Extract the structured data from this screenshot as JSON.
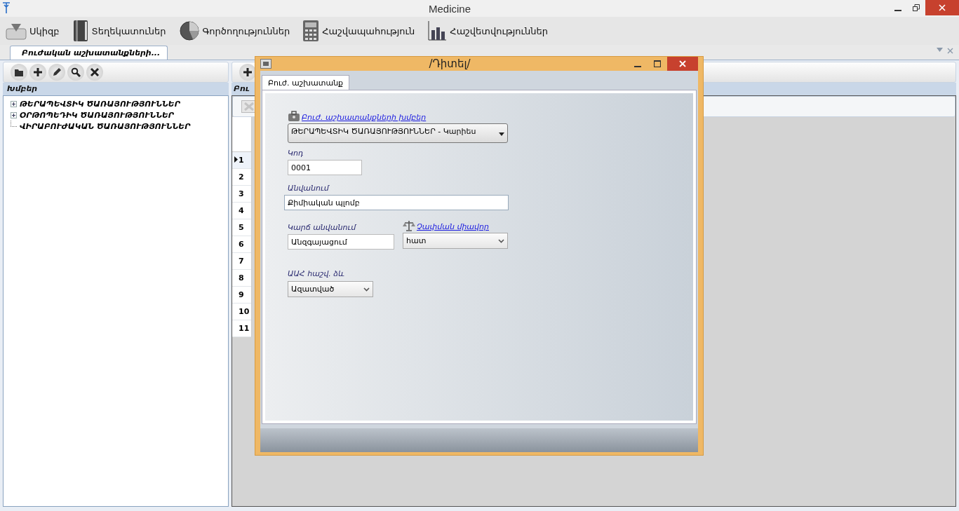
{
  "window": {
    "title": "Medicine"
  },
  "main_toolbar": [
    {
      "kind": "home",
      "label": "Սկիզբ"
    },
    {
      "kind": "book",
      "label": "Տեղեկատուներ"
    },
    {
      "kind": "pie",
      "label": "Գործողություններ"
    },
    {
      "kind": "calculator",
      "label": "Հաշվապահություն"
    },
    {
      "kind": "chart",
      "label": "Հաշվետվություններ"
    }
  ],
  "doc_tabs": [
    {
      "label": "Բուժական աշխատանքների...",
      "selected": true
    }
  ],
  "groups_panel": {
    "header": "Խմբեր",
    "tree": [
      {
        "label": "ԹԵՐԱՊԵՎՏԻԿ ԾԱՌԱՅՈՒԹՅՈՒՆՆԵՐ",
        "kind": "group"
      },
      {
        "label": "ՕՐԹՈՊԵԴԻԿ ԾԱՌԱՅՈՒԹՅՈՒՆՆԵՐ",
        "kind": "group"
      },
      {
        "label": "ՎԻՐԱԲՈՒԺԱԿԱՆ ԾԱՌԱՅՈՒԹՅՈՒՆՆԵՐ",
        "kind": "leaf"
      }
    ]
  },
  "services_panel": {
    "header": "Բու",
    "rows": [
      {
        "number": "1",
        "selected": true
      },
      {
        "number": "2",
        "selected": false
      },
      {
        "number": "3",
        "selected": false
      },
      {
        "number": "4",
        "selected": false
      },
      {
        "number": "5",
        "selected": false
      },
      {
        "number": "6",
        "selected": false
      },
      {
        "number": "7",
        "selected": false
      },
      {
        "number": "8",
        "selected": false
      },
      {
        "number": "9",
        "selected": false
      },
      {
        "number": "10",
        "selected": false
      },
      {
        "number": "11",
        "selected": false
      }
    ]
  },
  "dialog": {
    "title": "/Դիտել/",
    "tabs": [
      {
        "label": "Բուժ. աշխատանք",
        "selected": true
      }
    ],
    "group": {
      "link": "Բուժ. աշխատանքների խմբեր",
      "value": "ԹԵՐԱՊԵՎՏԻԿ ԾԱՌԱՅՈՒԹՅՈՒՆՆԵՐ - Կարիես"
    },
    "code": {
      "label": "Կոդ",
      "value": "0001"
    },
    "name": {
      "label": "Անվանում",
      "value": "Քիմիական պլոմբ"
    },
    "short_name": {
      "label": "Կարճ անվանում",
      "value": "Անզգայացում"
    },
    "unit": {
      "link": "Չափման միավոր",
      "value": "հատ"
    },
    "vat": {
      "label": "ԱԱՀ հաշվ. ձև",
      "value": "Ազատված"
    }
  }
}
